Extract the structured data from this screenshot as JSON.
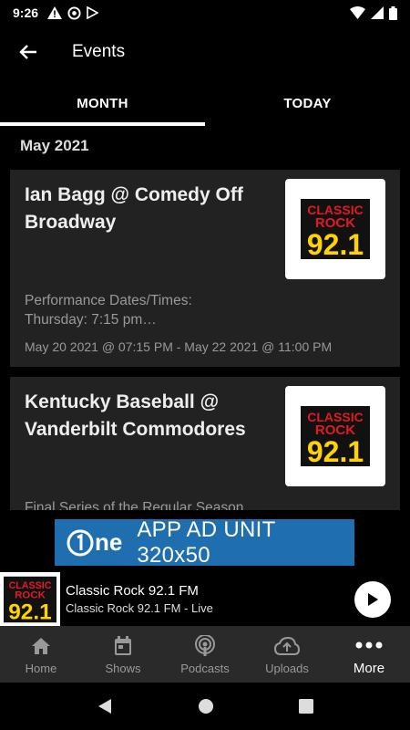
{
  "status_bar": {
    "time": "9:26"
  },
  "app_bar": {
    "title": "Events"
  },
  "tabs": [
    {
      "label": "MONTH",
      "active": true
    },
    {
      "label": "TODAY",
      "active": false
    }
  ],
  "section": {
    "month": "May 2021"
  },
  "events": [
    {
      "title": "Ian Bagg @ Comedy Off Broadway",
      "description": "Performance Dates/Times:\nThursday: 7:15 pm…",
      "dates": "May 20 2021 @ 07:15 PM - May 22 2021 @ 11:00 PM",
      "logo": {
        "line1": "CLASSIC",
        "line2": "ROCK",
        "line3": "92.1"
      }
    },
    {
      "title": "Kentucky Baseball @ Vanderbilt Commodores",
      "description": "Final Series of the Regular Season",
      "dates": "",
      "logo": {
        "line1": "CLASSIC",
        "line2": "ROCK",
        "line3": "92.1"
      }
    }
  ],
  "ad": {
    "brand": "ne",
    "text": "APP AD UNIT 320x50"
  },
  "player": {
    "title": "Classic Rock 92.1 FM",
    "subtitle": "Classic Rock 92.1 FM - Live",
    "logo": {
      "line1": "CLASSIC",
      "line2": "ROCK",
      "line3": "92.1"
    }
  },
  "bottom_nav": [
    {
      "label": "Home",
      "icon": "home-icon"
    },
    {
      "label": "Shows",
      "icon": "calendar-icon"
    },
    {
      "label": "Podcasts",
      "icon": "podcast-icon"
    },
    {
      "label": "Uploads",
      "icon": "cloud-upload-icon"
    },
    {
      "label": "More",
      "icon": "more-dots-icon",
      "active": true
    }
  ],
  "colors": {
    "background": "#000000",
    "card": "#222222",
    "nav_bar": "#2a2a2a",
    "ad_blue": "#1f6fb0",
    "logo_red": "#e11b22",
    "logo_yellow": "#ffd200"
  }
}
